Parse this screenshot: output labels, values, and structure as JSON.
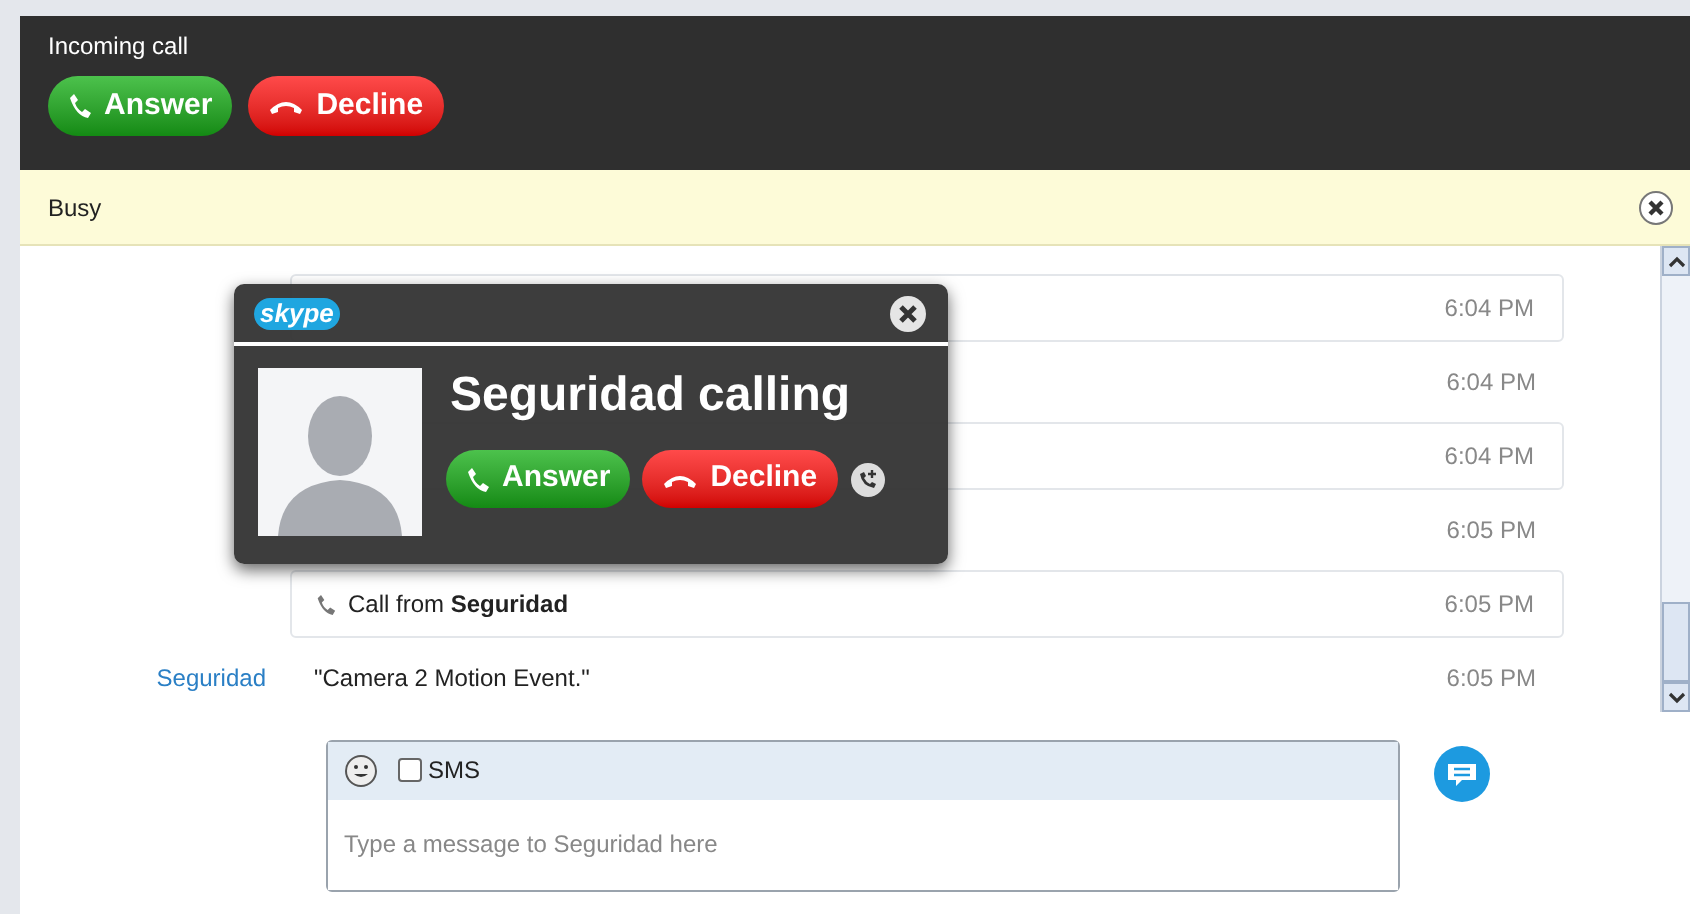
{
  "call_bar": {
    "title": "Incoming call",
    "answer": "Answer",
    "decline": "Decline"
  },
  "status_bar": {
    "text": "Busy"
  },
  "messages": [
    {
      "kind": "event",
      "time": "6:04 PM"
    },
    {
      "kind": "message",
      "time": "6:04 PM"
    },
    {
      "kind": "event",
      "time": "6:04 PM"
    },
    {
      "kind": "message",
      "time": "6:05 PM"
    },
    {
      "kind": "event",
      "text": "Call from **Seguridad**",
      "time": "6:05 PM"
    },
    {
      "kind": "message",
      "sender": "Seguridad",
      "text": "\"Camera 2 Motion Event.\"",
      "time": "6:05 PM"
    }
  ],
  "composer": {
    "sms_label": "SMS",
    "sms_checked": false,
    "placeholder": "Type a message to Seguridad here"
  },
  "popup": {
    "logo": "skype",
    "title": "Seguridad calling",
    "answer": "Answer",
    "decline": "Decline"
  }
}
